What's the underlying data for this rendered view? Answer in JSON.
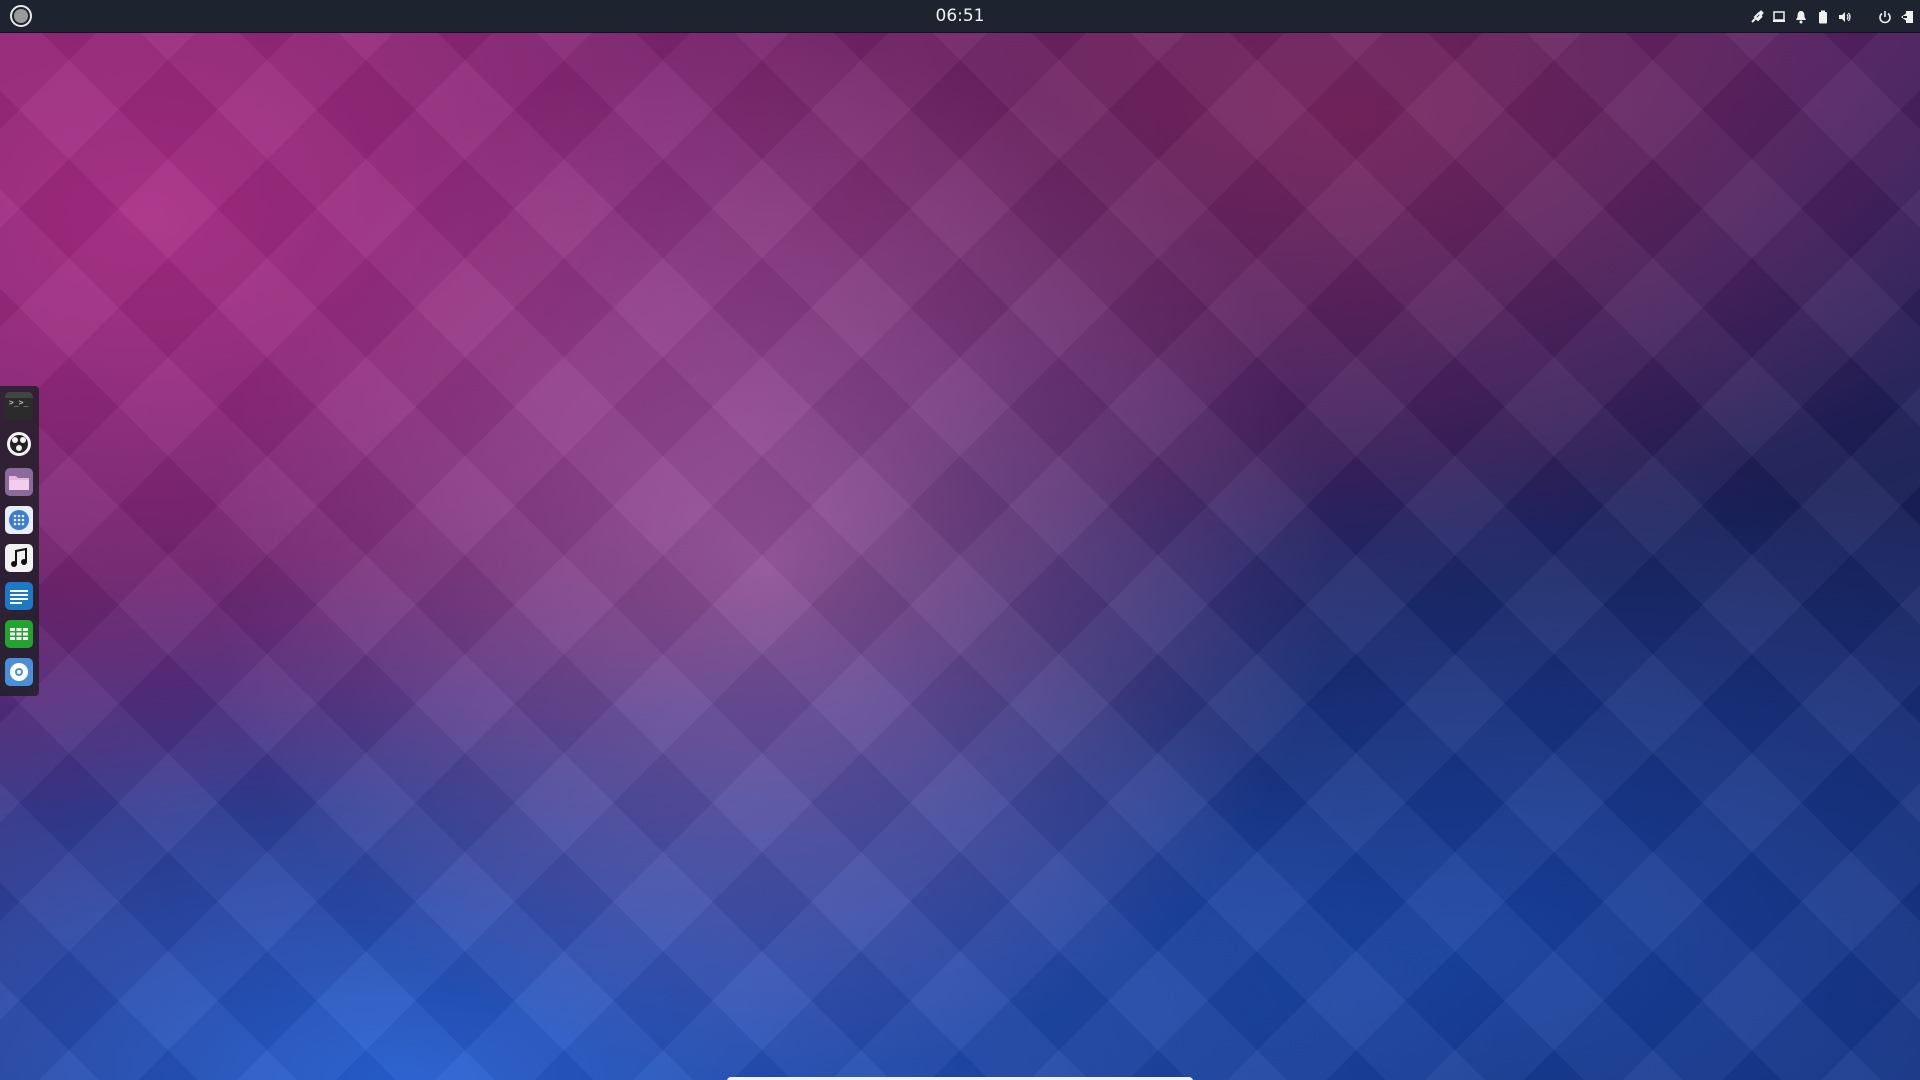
{
  "top_panel": {
    "clock": "06:51",
    "menu_icon": "os-menu-icon",
    "tray_icons": [
      "network-icon",
      "display-icon",
      "notification-bell-icon",
      "battery-icon",
      "volume-icon",
      "power-icon",
      "logout-icon"
    ]
  },
  "dock": {
    "items": [
      {
        "name": "terminal",
        "icon": "terminal-icon"
      },
      {
        "name": "browser",
        "icon": "browser-icon"
      },
      {
        "name": "files",
        "icon": "folder-icon"
      },
      {
        "name": "app-launcher",
        "icon": "app-grid-icon"
      },
      {
        "name": "music",
        "icon": "music-note-icon"
      },
      {
        "name": "text-editor",
        "icon": "document-icon"
      },
      {
        "name": "spreadsheet",
        "icon": "spreadsheet-icon"
      },
      {
        "name": "web-browser",
        "icon": "web-browser-icon"
      }
    ]
  },
  "colors": {
    "panel_bg": "#1d2430",
    "dock_bg": "#1e1e26",
    "wallpaper_magenta": "#a83a8a",
    "wallpaper_blue": "#1a4bb5"
  }
}
